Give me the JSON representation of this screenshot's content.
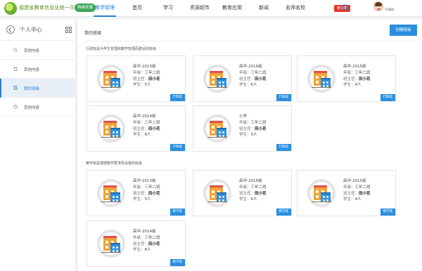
{
  "header": {
    "brand": "福建省教育信息化统一平台",
    "brand_tag": "跨越发展",
    "nav": [
      {
        "label": "教学管理",
        "active": true
      },
      {
        "label": "首页",
        "active": false
      },
      {
        "label": "学习",
        "active": false
      },
      {
        "label": "资源超市",
        "active": false
      },
      {
        "label": "教育应用",
        "active": false
      },
      {
        "label": "新闻",
        "active": false
      },
      {
        "label": "名师名校",
        "active": false
      }
    ],
    "nav_badge": "新功能",
    "username": "Coco"
  },
  "sidebar": {
    "title": "个人中心",
    "items": [
      {
        "label": "其他内容",
        "icon": "search-icon",
        "active": false
      },
      {
        "label": "其他内容",
        "icon": "trash-icon",
        "active": false
      },
      {
        "label": "我的班级",
        "icon": "document-icon",
        "active": true
      },
      {
        "label": "其他内容",
        "icon": "clock-icon",
        "active": false
      }
    ]
  },
  "main": {
    "title": "我的班级",
    "create_button": "创建班级",
    "admin_section_title": "行政班是为学生管理和教学管理而建设的班级",
    "teaching_section_title": "教学班是根据教学要求而设置的班级",
    "field_labels": {
      "grade": "年级：",
      "teacher": "班主任：",
      "students": "学生："
    },
    "admin_classes": [
      {
        "name": "高中-2013级",
        "grade": "三年二班",
        "teacher": "田小花",
        "students": "5人",
        "tag": "行政班"
      },
      {
        "name": "高中-2016级",
        "grade": "三年二班",
        "teacher": "田小花",
        "students": "6人",
        "tag": "行政班"
      },
      {
        "name": "高中-2015级",
        "grade": "三年二班",
        "teacher": "田小花",
        "students": "4人",
        "tag": "行政班"
      },
      {
        "name": "高中-2014级",
        "grade": "三年二班",
        "teacher": "田小花",
        "students": "8人",
        "tag": "行政班"
      },
      {
        "name": "小学",
        "grade": "三年二班",
        "teacher": "田小花",
        "students": "0人",
        "tag": "行政班"
      }
    ],
    "teaching_classes": [
      {
        "name": "高中-2013级",
        "grade": "三年二班",
        "teacher": "田小花",
        "students": "5人",
        "tag": "教学班"
      },
      {
        "name": "高中-2016级",
        "grade": "三年二班",
        "teacher": "田小花",
        "students": "6人",
        "tag": "教学班"
      },
      {
        "name": "高中-2015级",
        "grade": "三年二班",
        "teacher": "田小花",
        "students": "4人",
        "tag": "教学班"
      },
      {
        "name": "高中-2014级",
        "grade": "三年二班",
        "teacher": "田小花",
        "students": "8人",
        "tag": "教学班"
      }
    ]
  },
  "colors": {
    "accent": "#2b8fe0",
    "badge": "#e3362b",
    "brand_green": "#3aa655"
  }
}
